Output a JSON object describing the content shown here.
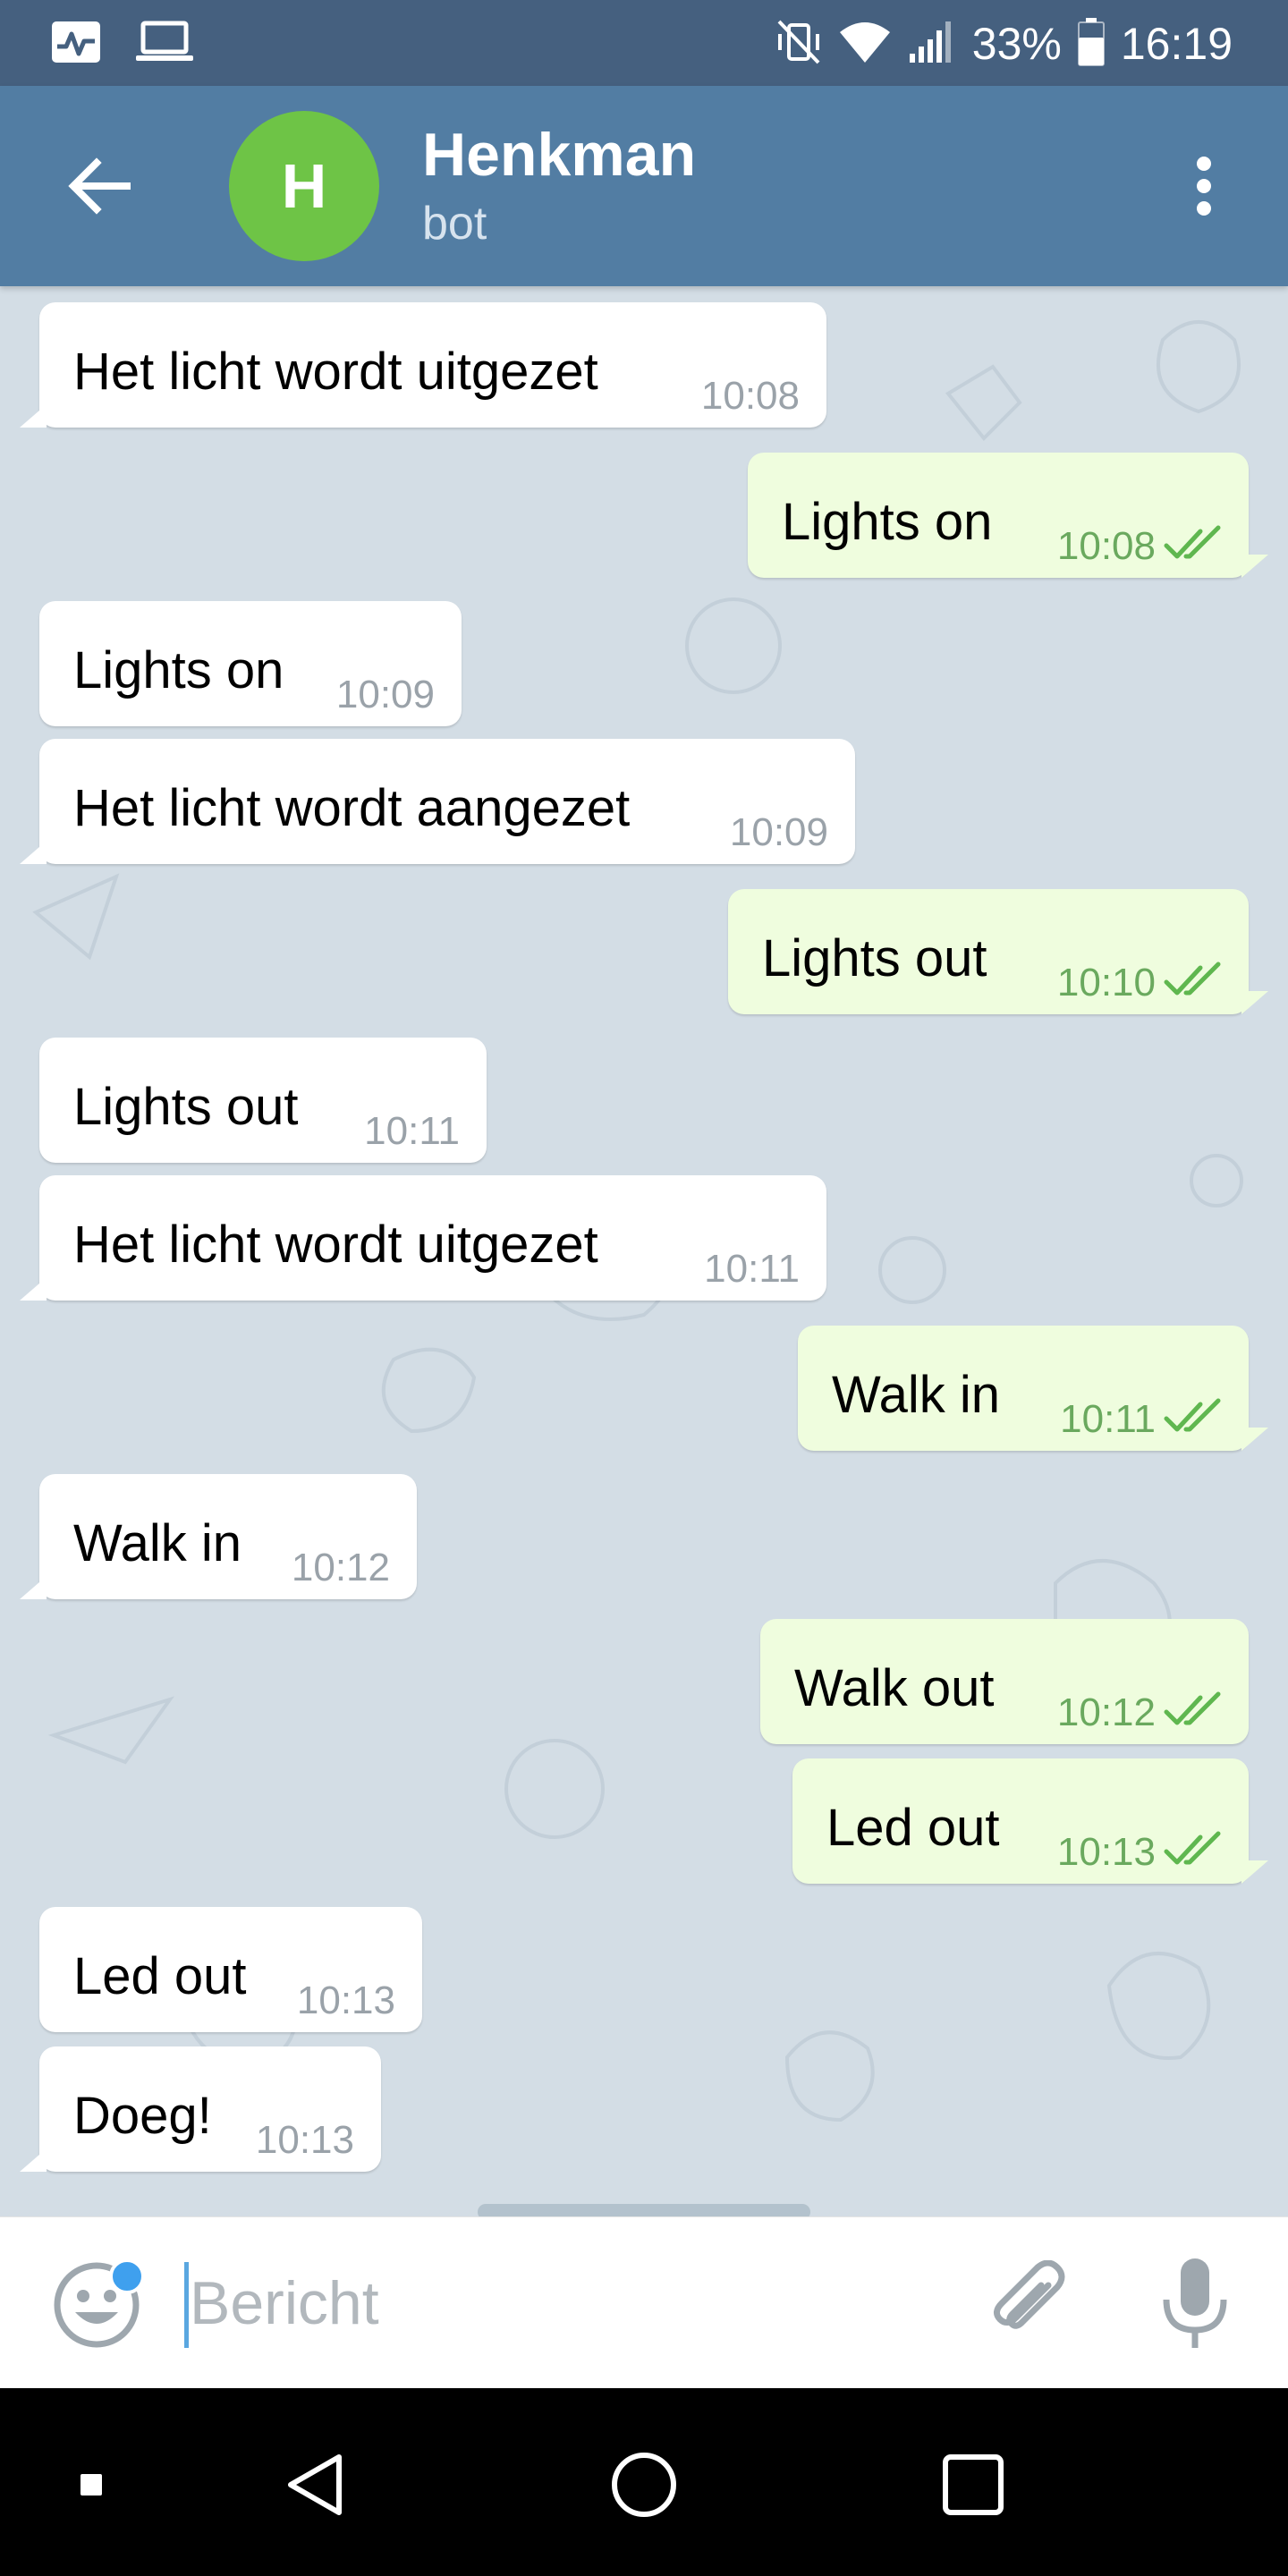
{
  "status_bar": {
    "battery": "33%",
    "time": "16:19"
  },
  "header": {
    "avatar_letter": "H",
    "avatar_color": "#6ec446",
    "title": "Henkman",
    "subtitle": "bot"
  },
  "messages": [
    {
      "dir": "in",
      "text": "Het licht wordt uitgezet",
      "time": "10:08"
    },
    {
      "dir": "out",
      "text": "Lights on",
      "time": "10:08",
      "status": "read"
    },
    {
      "dir": "in",
      "text": "Lights on",
      "time": "10:09"
    },
    {
      "dir": "in",
      "text": "Het licht wordt aangezet",
      "time": "10:09"
    },
    {
      "dir": "out",
      "text": "Lights out",
      "time": "10:10",
      "status": "read"
    },
    {
      "dir": "in",
      "text": "Lights out",
      "time": "10:11"
    },
    {
      "dir": "in",
      "text": "Het licht wordt uitgezet",
      "time": "10:11"
    },
    {
      "dir": "out",
      "text": "Walk in",
      "time": "10:11",
      "status": "read"
    },
    {
      "dir": "in",
      "text": "Walk in",
      "time": "10:12"
    },
    {
      "dir": "out",
      "text": "Walk out",
      "time": "10:12",
      "status": "read"
    },
    {
      "dir": "out",
      "text": "Led out",
      "time": "10:13",
      "status": "read"
    },
    {
      "dir": "in",
      "text": "Led out",
      "time": "10:13"
    },
    {
      "dir": "in",
      "text": "Doeg!",
      "time": "10:13"
    }
  ],
  "composer": {
    "placeholder": "Bericht"
  },
  "colors": {
    "status_bar": "#45607f",
    "app_bar": "#527da3",
    "incoming_bubble": "#ffffff",
    "outgoing_bubble": "#effdde",
    "read_check": "#5fb74f",
    "chat_background": "#d3dde5"
  },
  "icons": {
    "status_left": [
      "activity-monitor-icon",
      "laptop-icon"
    ],
    "status_right": [
      "mute-vibrate-icon",
      "wifi-icon",
      "signal-icon",
      "battery-icon"
    ],
    "header": [
      "back-arrow-icon",
      "more-vert-icon"
    ],
    "composer": [
      "emoji-icon",
      "attach-icon",
      "mic-icon"
    ],
    "nav": [
      "nav-recent-square-icon",
      "nav-back-triangle-icon",
      "nav-home-circle-icon",
      "nav-overview-square-icon"
    ]
  }
}
